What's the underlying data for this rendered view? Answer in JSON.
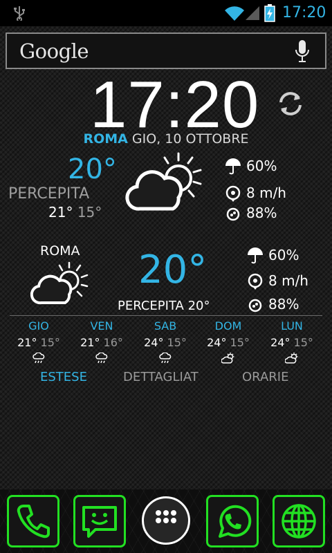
{
  "status_bar": {
    "time": "17:20",
    "icons": [
      "usb-icon",
      "wifi-icon",
      "signal-icon",
      "battery-charging-icon"
    ],
    "accent_color": "#33b5e5"
  },
  "search": {
    "logo": "Google",
    "mic_icon": "microphone-icon"
  },
  "clock_widget": {
    "time": "17:20",
    "city": "ROMA",
    "date": "GIO, 10 OTTOBRE",
    "refresh_icon": "refresh-icon"
  },
  "weather_small": {
    "temperature": "20°",
    "feels_label": "PERCEPITA",
    "max": "21°",
    "min": "15°",
    "icon": "partly-cloudy-icon",
    "rain": "60%",
    "wind": "8 m/h",
    "humidity": "88%"
  },
  "weather_large": {
    "city": "ROMA",
    "temperature": "20°",
    "feels": "PERCEPITA 20°",
    "icon": "partly-cloudy-icon",
    "rain": "60%",
    "wind": "8 m/h",
    "humidity": "88%"
  },
  "forecast": [
    {
      "day": "GIO",
      "max": "21°",
      "min": "15°",
      "icon": "rain-cloud-icon"
    },
    {
      "day": "VEN",
      "max": "21°",
      "min": "16°",
      "icon": "rain-cloud-icon"
    },
    {
      "day": "SAB",
      "max": "24°",
      "min": "15°",
      "icon": "rain-cloud-icon"
    },
    {
      "day": "DOM",
      "max": "24°",
      "min": "15°",
      "icon": "sun-cloud-icon"
    },
    {
      "day": "LUN",
      "max": "24°",
      "min": "15°",
      "icon": "sun-cloud-icon"
    }
  ],
  "tabs": [
    {
      "label": "ESTESE",
      "active": true
    },
    {
      "label": "DETTAGLIAT",
      "active": false
    },
    {
      "label": "ORARIE",
      "active": false
    }
  ],
  "dock": {
    "accent_color": "#22e022",
    "items": [
      "phone-icon",
      "messaging-icon",
      "app-drawer-icon",
      "whatsapp-icon",
      "browser-globe-icon"
    ]
  }
}
